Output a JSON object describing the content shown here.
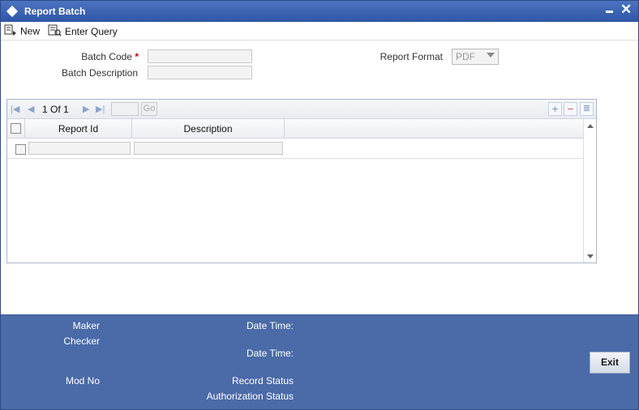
{
  "window": {
    "title": "Report Batch"
  },
  "toolbar": {
    "new_label": "New",
    "enter_query_label": "Enter Query"
  },
  "form": {
    "batch_code_label": "Batch Code",
    "required_marker": "*",
    "batch_code_value": "",
    "batch_description_label": "Batch Description",
    "batch_description_value": "",
    "report_format_label": "Report Format",
    "report_format_value": "PDF"
  },
  "grid": {
    "pager_current": "1",
    "pager_of": "Of",
    "pager_total": "1",
    "go_label": "Go",
    "columns": [
      "Report Id",
      "Description"
    ],
    "rows": [
      {
        "report_id": "",
        "description": ""
      }
    ]
  },
  "footer": {
    "maker_label": "Maker",
    "checker_label": "Checker",
    "date_time_label_1": "Date Time:",
    "date_time_label_2": "Date Time:",
    "mod_no_label": "Mod No",
    "record_status_label": "Record Status",
    "authorization_status_label": "Authorization Status",
    "exit_label": "Exit"
  }
}
